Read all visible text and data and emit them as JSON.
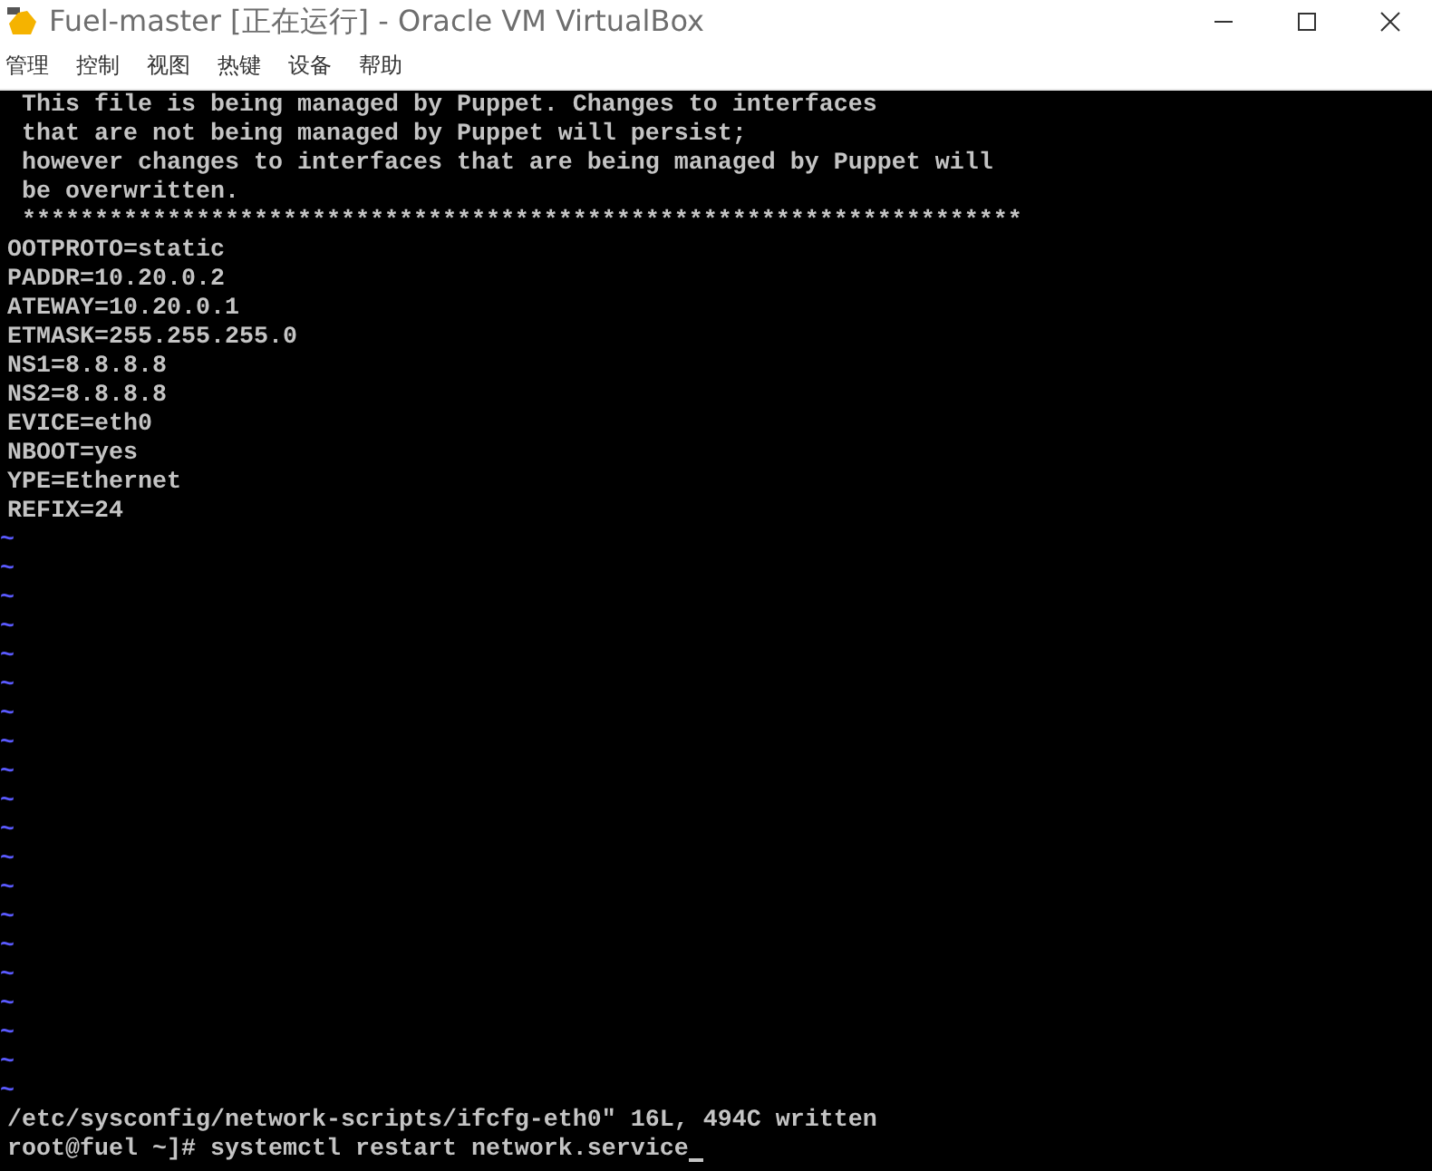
{
  "window": {
    "title": "Fuel-master [正在运行] - Oracle VM VirtualBox"
  },
  "menu": [
    "管理",
    "控制",
    "视图",
    "热键",
    "设备",
    "帮助"
  ],
  "terminal": {
    "lines": [
      {
        "kind": "text",
        "text": " This file is being managed by Puppet. Changes to interfaces"
      },
      {
        "kind": "text",
        "text": " that are not being managed by Puppet will persist;"
      },
      {
        "kind": "text",
        "text": " however changes to interfaces that are being managed by Puppet will"
      },
      {
        "kind": "text",
        "text": " be overwritten."
      },
      {
        "kind": "text",
        "text": " *********************************************************************"
      },
      {
        "kind": "text",
        "text": "OOTPROTO=static"
      },
      {
        "kind": "text",
        "text": "PADDR=10.20.0.2"
      },
      {
        "kind": "text",
        "text": "ATEWAY=10.20.0.1"
      },
      {
        "kind": "text",
        "text": "ETMASK=255.255.255.0"
      },
      {
        "kind": "text",
        "text": "NS1=8.8.8.8"
      },
      {
        "kind": "text",
        "text": "NS2=8.8.8.8"
      },
      {
        "kind": "text",
        "text": "EVICE=eth0"
      },
      {
        "kind": "text",
        "text": "NBOOT=yes"
      },
      {
        "kind": "text",
        "text": "YPE=Ethernet"
      },
      {
        "kind": "text",
        "text": "REFIX=24"
      },
      {
        "kind": "tilde",
        "text": "~"
      },
      {
        "kind": "tilde",
        "text": "~"
      },
      {
        "kind": "tilde",
        "text": "~"
      },
      {
        "kind": "tilde",
        "text": "~"
      },
      {
        "kind": "tilde",
        "text": "~"
      },
      {
        "kind": "tilde",
        "text": "~"
      },
      {
        "kind": "tilde",
        "text": "~"
      },
      {
        "kind": "tilde",
        "text": "~"
      },
      {
        "kind": "tilde",
        "text": "~"
      },
      {
        "kind": "tilde",
        "text": "~"
      },
      {
        "kind": "tilde",
        "text": "~"
      },
      {
        "kind": "tilde",
        "text": "~"
      },
      {
        "kind": "tilde",
        "text": "~"
      },
      {
        "kind": "tilde",
        "text": "~"
      },
      {
        "kind": "tilde",
        "text": "~"
      },
      {
        "kind": "tilde",
        "text": "~"
      },
      {
        "kind": "tilde",
        "text": "~"
      },
      {
        "kind": "tilde",
        "text": "~"
      },
      {
        "kind": "tilde",
        "text": "~"
      },
      {
        "kind": "tilde",
        "text": "~"
      },
      {
        "kind": "text",
        "text": "/etc/sysconfig/network-scripts/ifcfg-eth0\" 16L, 494C written"
      },
      {
        "kind": "prompt",
        "text": "root@fuel ~]# systemctl restart network.service"
      }
    ]
  }
}
